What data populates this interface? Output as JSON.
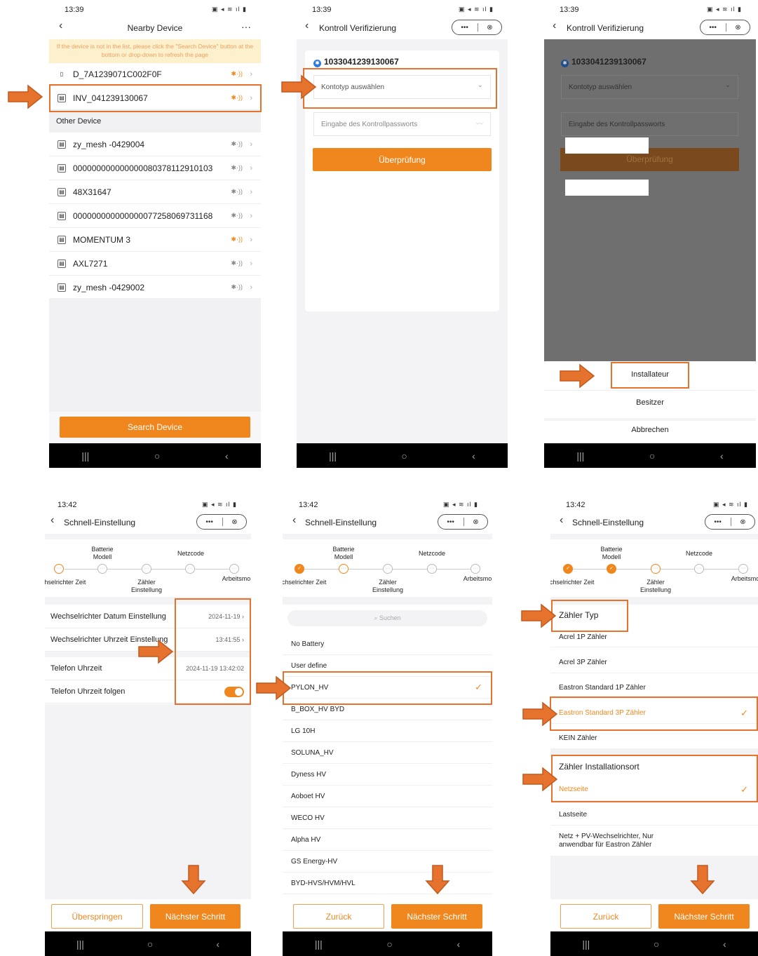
{
  "colors": {
    "accent": "#f0871e",
    "annotation": "#e6732d"
  },
  "p1": {
    "time": "13:39",
    "title": "Nearby Device",
    "more": "···",
    "notice": "If the device is not in the list, please click the \"Search Device\" button at the bottom or drop-down to refresh the page",
    "nearby": [
      {
        "name": "D_7A1239071C002F0F"
      },
      {
        "name": "INV_041239130067"
      }
    ],
    "other_header": "Other Device",
    "others": [
      {
        "name": "zy_mesh -0429004"
      },
      {
        "name": "000000000000000080378112910103"
      },
      {
        "name": "48X31647"
      },
      {
        "name": "000000000000000077258069731168"
      },
      {
        "name": "MOMENTUM 3"
      },
      {
        "name": "AXL7271"
      },
      {
        "name": "zy_mesh -0429002"
      }
    ],
    "button": "Search Device"
  },
  "p2": {
    "time": "13:39",
    "title": "Kontroll Verifizierung",
    "device_id": "1033041239130067",
    "select_placeholder": "Kontotyp auswählen",
    "password_placeholder": "Eingabe des Kontrollpassworts",
    "button": "Überprüfung"
  },
  "p3": {
    "time": "13:39",
    "title": "Kontroll Verifizierung",
    "device_id": "1033041239130067",
    "select_placeholder": "Kontotyp auswählen",
    "password_placeholder": "Eingabe des Kontrollpassworts",
    "button": "Überprüfung",
    "sheet": {
      "installer": "Installateur",
      "owner": "Besitzer",
      "cancel": "Abbrechen"
    }
  },
  "steps": {
    "s1": "Wechselrichter Zeit",
    "s2": "Batterie Modell",
    "s3": "Zähler Einstellung",
    "s4": "Netzcode",
    "s5": "Arbeitsmo"
  },
  "p4": {
    "time": "13:42",
    "title": "Schnell-Einstellung",
    "rows": [
      {
        "label": "Wechselrichter Datum Einstellung",
        "value": "2024-11-19"
      },
      {
        "label": "Wechselrichter Uhrzeit Einstellung",
        "value": "13:41:55"
      },
      {
        "label": "Telefon Uhrzeit",
        "value": "2024-11-19 13:42:02"
      },
      {
        "label": "Telefon Uhrzeit folgen",
        "value": ""
      }
    ],
    "skip": "Überspringen",
    "next": "Nächster Schritt"
  },
  "p5": {
    "time": "13:42",
    "title": "Schnell-Einstellung",
    "search": "Suchen",
    "items": [
      {
        "name": "No Battery"
      },
      {
        "name": "User define"
      },
      {
        "name": "PYLON_HV"
      },
      {
        "name": "B_BOX_HV BYD"
      },
      {
        "name": "LG 10H"
      },
      {
        "name": "SOLUNA_HV"
      },
      {
        "name": "Dyness HV"
      },
      {
        "name": "Aoboet HV"
      },
      {
        "name": "WECO HV"
      },
      {
        "name": "Alpha HV"
      },
      {
        "name": "GS Energy-HV"
      },
      {
        "name": "BYD-HVS/HVM/HVL"
      }
    ],
    "selected": "PYLON_HV",
    "back": "Zurück",
    "next": "Nächster Schritt"
  },
  "p6": {
    "time": "13:42",
    "title": "Schnell-Einstellung",
    "type_header": "Zähler Typ",
    "types": [
      {
        "name": "Acrel 1P Zähler"
      },
      {
        "name": "Acrel 3P Zähler"
      },
      {
        "name": "Eastron Standard 1P Zähler"
      },
      {
        "name": "Eastron Standard 3P Zähler"
      },
      {
        "name": "KEIN Zähler"
      }
    ],
    "loc_header": "Zähler Installationsort",
    "locs": [
      {
        "name": "Netzseite"
      },
      {
        "name": "Lastseite"
      },
      {
        "name": "Netz + PV-Wechselrichter, Nur anwendbar für Eastron Zähler"
      }
    ],
    "back": "Zurück",
    "next": "Nächster Schritt"
  },
  "icons": {
    "check": "✓",
    "chevron": "›",
    "bluetooth": "✱·))",
    "back": "‹"
  }
}
